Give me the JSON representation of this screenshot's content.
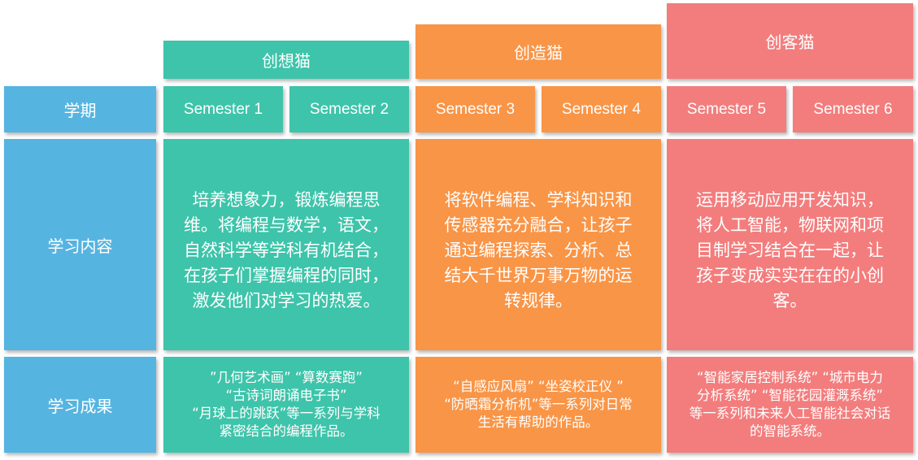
{
  "groups": [
    {
      "name": "创想猫",
      "color": "#3ec4aa"
    },
    {
      "name": "创造猫",
      "color": "#f99547"
    },
    {
      "name": "创客猫",
      "color": "#f37d7d"
    }
  ],
  "row_labels": {
    "semester": "学期",
    "content": "学习内容",
    "results": "学习成果"
  },
  "semesters": [
    "Semester 1",
    "Semester 2",
    "Semester 3",
    "Semester 4",
    "Semester 5",
    "Semester 6"
  ],
  "content": [
    [
      "培养想象力，锻炼编程思",
      "维。将编程与数学，语文，",
      "自然科学等学科有机结合，",
      "在孩子们掌握编程的同时，",
      "激发他们对学习的热爱。"
    ],
    [
      "将软件编程、学科知识和",
      "传感器充分融合，让孩子",
      "通过编程探索、分析、总",
      "结大千世界万事万物的运",
      "转规律。"
    ],
    [
      "运用移动应用开发知识，",
      "将人工智能，物联网和项",
      "目制学习结合在一起，让",
      "孩子变成实实在在的小创",
      "客。"
    ]
  ],
  "results": [
    [
      "”几何艺术画” “算数赛跑”",
      "“古诗词朗诵电子书”",
      "“月球上的跳跃”等一系列与学科",
      "紧密结合的编程作品。"
    ],
    [
      "“自感应风扇” “坐姿校正仪 ”",
      "“防晒霜分析机”等一系列对日常",
      "生活有帮助的作品。"
    ],
    [
      "“智能家居控制系统” “城市电力",
      "分析系统” “智能花园灌溉系统”",
      "等一系列和未来人工智能社会对话",
      "的智能系统。"
    ]
  ],
  "colors": {
    "label_blue": "#56b4e0",
    "teal": "#3ec4aa",
    "orange": "#f99547",
    "pink": "#f37d7d"
  }
}
